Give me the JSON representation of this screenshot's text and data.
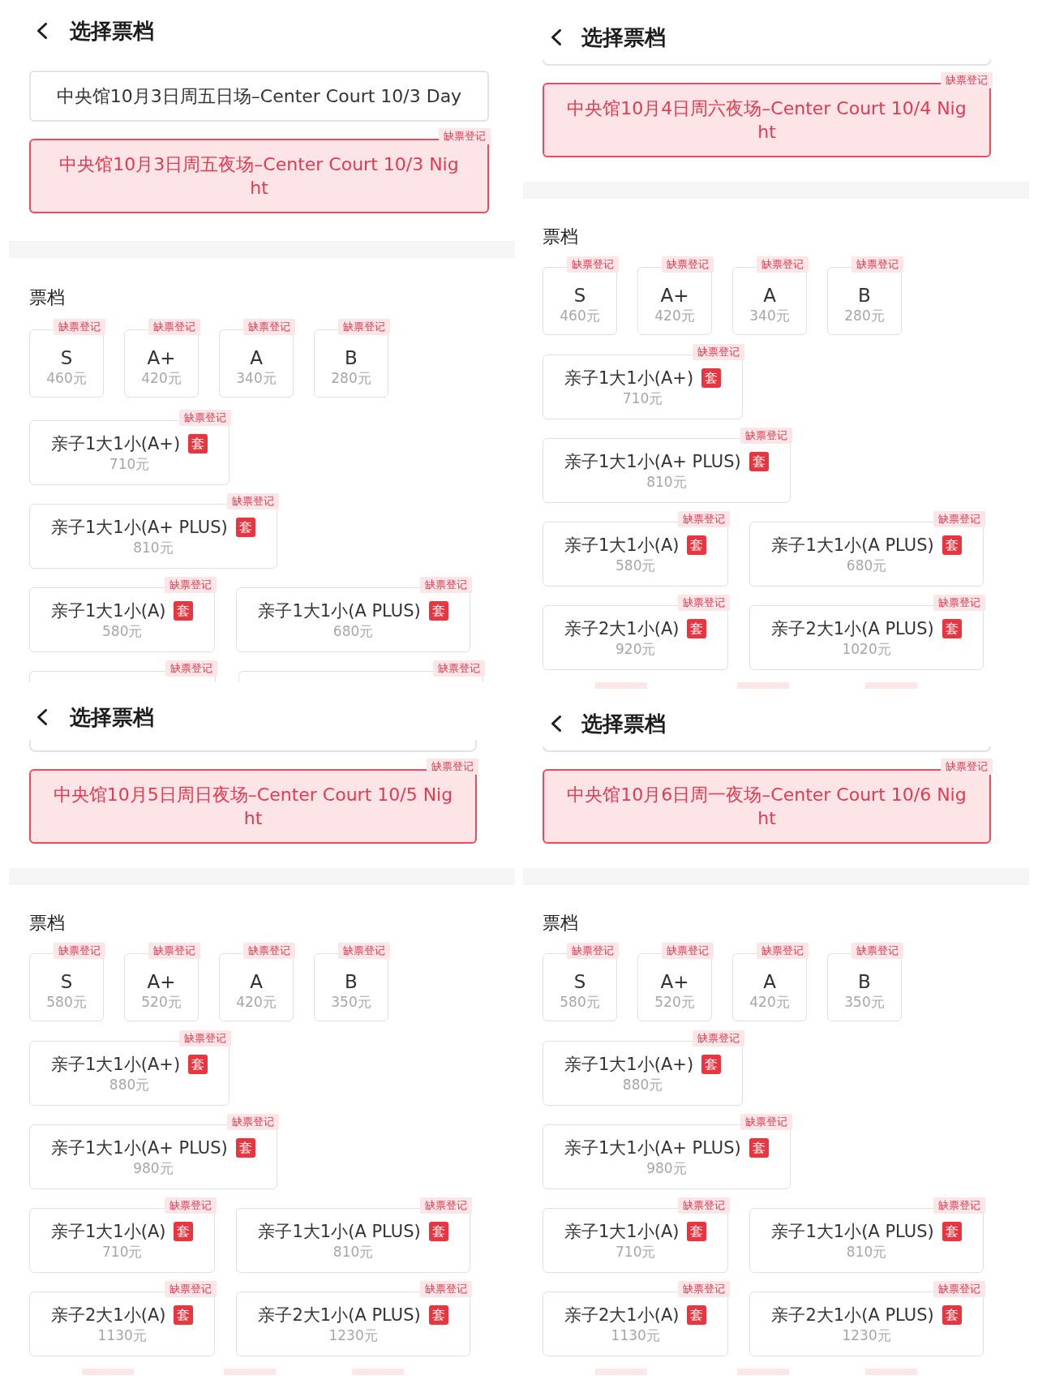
{
  "panels": [
    {
      "header": {
        "title": "选择票档"
      },
      "sessions": [
        {
          "kind": "session",
          "label": "中央馆10月3日周五日场–Center Court 10/3 Day",
          "selected": false
        },
        {
          "kind": "session",
          "label": "中央馆10月3日周五夜场–Center Court 10/3 Night",
          "selected": true,
          "badge": "缺票登记"
        }
      ],
      "section_title": "票档",
      "tiers": [
        {
          "name": "S",
          "price": "460元",
          "badge": "缺票登记",
          "selected": false
        },
        {
          "name": "A+",
          "price": "420元",
          "badge": "缺票登记",
          "selected": false
        },
        {
          "name": "A",
          "price": "340元",
          "badge": "缺票登记",
          "selected": false
        },
        {
          "name": "B",
          "price": "280元",
          "badge": "缺票登记",
          "selected": false
        }
      ],
      "package_rows": [
        [
          {
            "kind": "package",
            "name": "亲子1大1小(A+)",
            "tag": "套",
            "price": "710元",
            "badge": "缺票登记",
            "selected": false
          }
        ],
        [
          {
            "kind": "package",
            "name": "亲子1大1小(A+ PLUS)",
            "tag": "套",
            "price": "810元",
            "badge": "缺票登记",
            "selected": false
          }
        ],
        [
          {
            "kind": "package",
            "name": "亲子1大1小(A)",
            "tag": "套",
            "price": "580元",
            "badge": "缺票登记",
            "selected": false
          },
          {
            "kind": "package",
            "name": "亲子1大1小(A PLUS)",
            "tag": "套",
            "price": "680元",
            "badge": "缺票登记",
            "selected": false
          }
        ],
        [
          {
            "kind": "cut",
            "badge": "缺票登记",
            "selected": false
          },
          {
            "kind": "cut",
            "badge": "缺票登记",
            "selected": false
          }
        ]
      ]
    },
    {
      "header": {
        "title": "选择票档"
      },
      "sessions": [
        {
          "kind": "edge",
          "selected": false
        },
        {
          "kind": "session",
          "label": "中央馆10月4日周六夜场–Center Court 10/4 Night",
          "selected": true,
          "badge": "缺票登记"
        }
      ],
      "section_title": "票档",
      "tiers": [
        {
          "name": "S",
          "price": "460元",
          "badge": "缺票登记",
          "selected": false
        },
        {
          "name": "A+",
          "price": "420元",
          "badge": "缺票登记",
          "selected": false
        },
        {
          "name": "A",
          "price": "340元",
          "badge": "缺票登记",
          "selected": false
        },
        {
          "name": "B",
          "price": "280元",
          "badge": "缺票登记",
          "selected": false
        }
      ],
      "package_rows": [
        [
          {
            "kind": "package",
            "name": "亲子1大1小(A+)",
            "tag": "套",
            "price": "710元",
            "badge": "缺票登记",
            "selected": false
          }
        ],
        [
          {
            "kind": "package",
            "name": "亲子1大1小(A+ PLUS)",
            "tag": "套",
            "price": "810元",
            "badge": "缺票登记",
            "selected": false
          }
        ],
        [
          {
            "kind": "package",
            "name": "亲子1大1小(A)",
            "tag": "套",
            "price": "580元",
            "badge": "缺票登记",
            "selected": false
          },
          {
            "kind": "package",
            "name": "亲子1大1小(A PLUS)",
            "tag": "套",
            "price": "680元",
            "badge": "缺票登记",
            "selected": false
          }
        ],
        [
          {
            "kind": "package",
            "name": "亲子2大1小(A)",
            "tag": "套",
            "price": "920元",
            "badge": "缺票登记",
            "selected": false
          },
          {
            "kind": "package",
            "name": "亲子2大1小(A PLUS)",
            "tag": "套",
            "price": "1020元",
            "badge": "缺票登记",
            "selected": false
          }
        ],
        [
          {
            "kind": "sliver"
          },
          {
            "kind": "sliver"
          },
          {
            "kind": "sliver"
          }
        ]
      ]
    },
    {
      "header": {
        "title": "选择票档"
      },
      "sessions": [
        {
          "kind": "edge",
          "selected": false
        },
        {
          "kind": "session",
          "label": "中央馆10月5日周日夜场–Center Court 10/5 Night",
          "selected": true,
          "badge": "缺票登记"
        }
      ],
      "section_title": "票档",
      "tiers": [
        {
          "name": "S",
          "price": "580元",
          "badge": "缺票登记",
          "selected": false
        },
        {
          "name": "A+",
          "price": "520元",
          "badge": "缺票登记",
          "selected": false
        },
        {
          "name": "A",
          "price": "420元",
          "badge": "缺票登记",
          "selected": false
        },
        {
          "name": "B",
          "price": "350元",
          "badge": "缺票登记",
          "selected": false
        }
      ],
      "package_rows": [
        [
          {
            "kind": "package",
            "name": "亲子1大1小(A+)",
            "tag": "套",
            "price": "880元",
            "badge": "缺票登记",
            "selected": false
          }
        ],
        [
          {
            "kind": "package",
            "name": "亲子1大1小(A+ PLUS)",
            "tag": "套",
            "price": "980元",
            "badge": "缺票登记",
            "selected": false
          }
        ],
        [
          {
            "kind": "package",
            "name": "亲子1大1小(A)",
            "tag": "套",
            "price": "710元",
            "badge": "缺票登记",
            "selected": false
          },
          {
            "kind": "package",
            "name": "亲子1大1小(A PLUS)",
            "tag": "套",
            "price": "810元",
            "badge": "缺票登记",
            "selected": false
          }
        ],
        [
          {
            "kind": "package",
            "name": "亲子2大1小(A)",
            "tag": "套",
            "price": "1130元",
            "badge": "缺票登记",
            "selected": false
          },
          {
            "kind": "package",
            "name": "亲子2大1小(A PLUS)",
            "tag": "套",
            "price": "1230元",
            "badge": "缺票登记",
            "selected": false
          }
        ],
        [
          {
            "kind": "sliver"
          },
          {
            "kind": "sliver"
          },
          {
            "kind": "sliver"
          }
        ]
      ]
    },
    {
      "header": {
        "title": "选择票档"
      },
      "sessions": [
        {
          "kind": "edge",
          "selected": false
        },
        {
          "kind": "session",
          "label": "中央馆10月6日周一夜场–Center Court 10/6 Night",
          "selected": true,
          "badge": "缺票登记"
        }
      ],
      "section_title": "票档",
      "tiers": [
        {
          "name": "S",
          "price": "580元",
          "badge": "缺票登记",
          "selected": false
        },
        {
          "name": "A+",
          "price": "520元",
          "badge": "缺票登记",
          "selected": false
        },
        {
          "name": "A",
          "price": "420元",
          "badge": "缺票登记",
          "selected": false
        },
        {
          "name": "B",
          "price": "350元",
          "badge": "缺票登记",
          "selected": false
        }
      ],
      "package_rows": [
        [
          {
            "kind": "package",
            "name": "亲子1大1小(A+)",
            "tag": "套",
            "price": "880元",
            "badge": "缺票登记",
            "selected": false
          }
        ],
        [
          {
            "kind": "package",
            "name": "亲子1大1小(A+ PLUS)",
            "tag": "套",
            "price": "980元",
            "badge": "缺票登记",
            "selected": false
          }
        ],
        [
          {
            "kind": "package",
            "name": "亲子1大1小(A)",
            "tag": "套",
            "price": "710元",
            "badge": "缺票登记",
            "selected": false
          },
          {
            "kind": "package",
            "name": "亲子1大1小(A PLUS)",
            "tag": "套",
            "price": "810元",
            "badge": "缺票登记",
            "selected": false
          }
        ],
        [
          {
            "kind": "package",
            "name": "亲子2大1小(A)",
            "tag": "套",
            "price": "1130元",
            "badge": "缺票登记",
            "selected": false
          },
          {
            "kind": "package",
            "name": "亲子2大1小(A PLUS)",
            "tag": "套",
            "price": "1230元",
            "badge": "缺票登记",
            "selected": false
          }
        ],
        [
          {
            "kind": "sliver"
          },
          {
            "kind": "sliver"
          },
          {
            "kind": "sliver"
          }
        ]
      ]
    }
  ]
}
